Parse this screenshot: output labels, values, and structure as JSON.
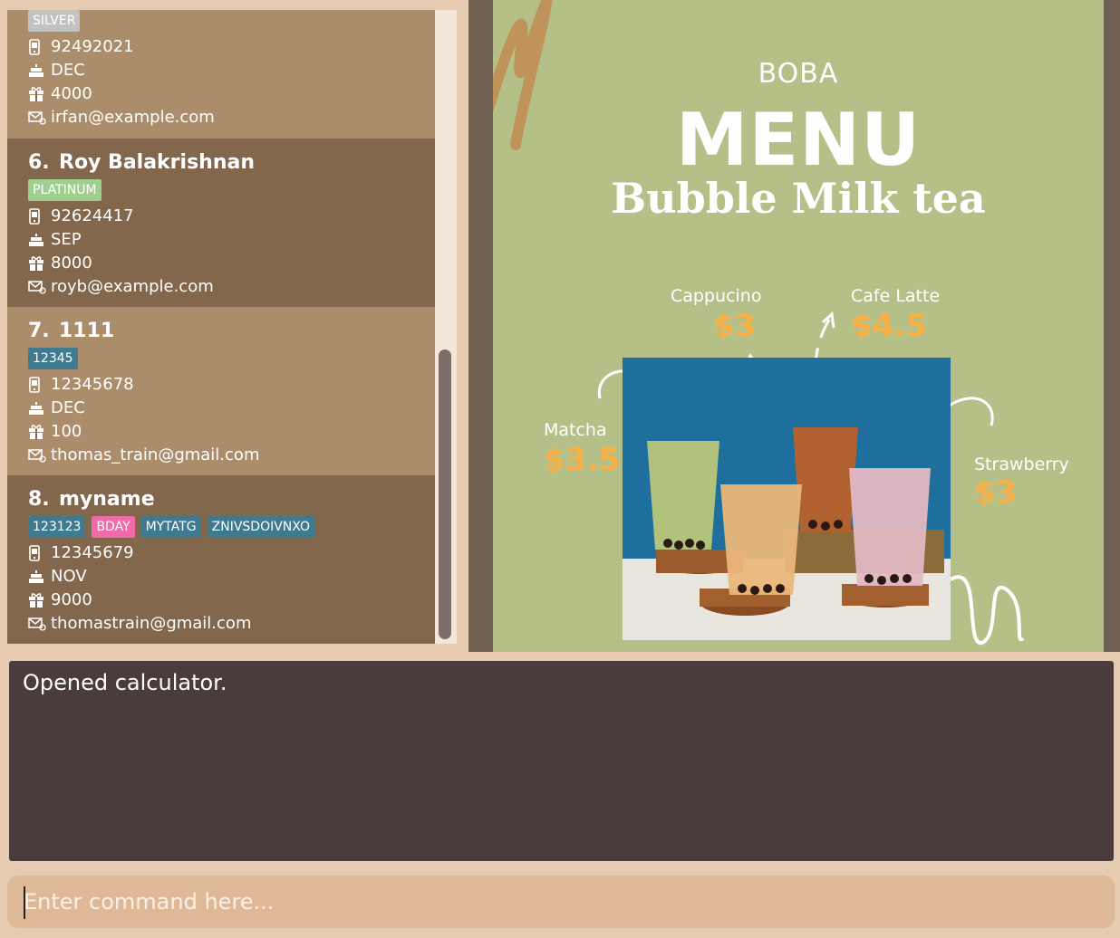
{
  "contacts": [
    {
      "name": "",
      "index": "",
      "tags": [
        {
          "label": "SILVER",
          "color": "#c2c2c2"
        }
      ],
      "phone": "92492021",
      "birthday": "DEC",
      "points": "4000",
      "email": "irfan@example.com"
    },
    {
      "index": "6.",
      "name": "Roy Balakrishnan",
      "tags": [
        {
          "label": "PLATINUM",
          "color": "#9fcf8f"
        }
      ],
      "phone": "92624417",
      "birthday": "SEP",
      "points": "8000",
      "email": "royb@example.com"
    },
    {
      "index": "7.",
      "name": "1111",
      "tags": [
        {
          "label": "12345",
          "color": "#3e7b91"
        }
      ],
      "phone": "12345678",
      "birthday": "DEC",
      "points": "100",
      "email": "thomas_train@gmail.com"
    },
    {
      "index": "8.",
      "name": "myname",
      "tags": [
        {
          "label": "123123",
          "color": "#3e7b91"
        },
        {
          "label": "BDAY",
          "color": "#f26aa7"
        },
        {
          "label": "MYTATG",
          "color": "#3e7b91"
        },
        {
          "label": "ZNIVSDOIVNXO",
          "color": "#3e7b91"
        }
      ],
      "phone": "12345679",
      "birthday": "NOV",
      "points": "9000",
      "email": "thomastrain@gmail.com"
    }
  ],
  "poster": {
    "top": "BOBA",
    "title": "MENU",
    "subtitle": "Bubble Milk tea",
    "drinks": {
      "cappucino": {
        "name": "Cappucino",
        "price": "$3"
      },
      "cafe_latte": {
        "name": "Cafe Latte",
        "price": "$4.5"
      },
      "matcha": {
        "name": "Matcha",
        "price": "$3.5"
      },
      "strawberry": {
        "name": "Strawberry",
        "price": "$3"
      }
    }
  },
  "result": {
    "text": "Opened calculator."
  },
  "command": {
    "placeholder": "Enter command here..."
  },
  "icons": {
    "phone": "phone-icon",
    "birthday": "cake-icon",
    "points": "gift-icon",
    "email": "mail-icon"
  }
}
